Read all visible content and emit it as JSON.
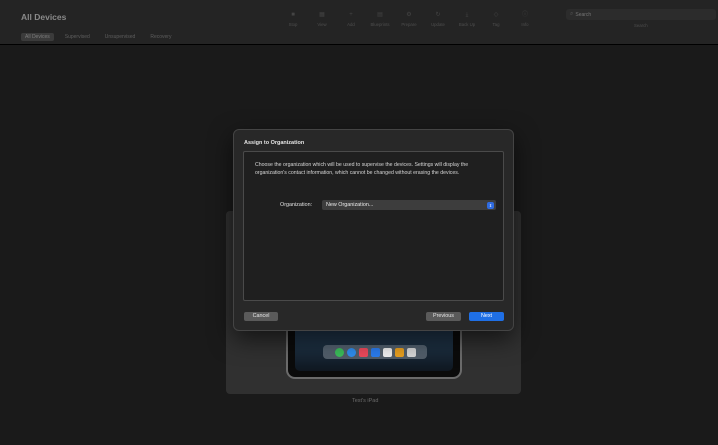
{
  "app": {
    "title": "All Devices",
    "filter_tabs": [
      "All Devices",
      "Supervised",
      "Unsupervised",
      "Recovery"
    ]
  },
  "toolbar": {
    "items": [
      {
        "label": "Stop",
        "icon": "stop-icon"
      },
      {
        "label": "View",
        "icon": "view-icon"
      },
      {
        "label": "Add",
        "icon": "add-icon"
      },
      {
        "label": "Blueprints",
        "icon": "blueprints-icon"
      },
      {
        "label": "Prepare",
        "icon": "prepare-icon"
      },
      {
        "label": "Update",
        "icon": "update-icon"
      },
      {
        "label": "Back Up",
        "icon": "backup-icon"
      },
      {
        "label": "Tag",
        "icon": "tag-icon"
      },
      {
        "label": "Info",
        "icon": "info-icon"
      }
    ],
    "search_placeholder": "Search",
    "search_label": "Search"
  },
  "dialog": {
    "title": "Assign to Organization",
    "description": "Choose the organization which will be used to supervise the devices. Settings will display the organization's contact information, which cannot be changed without erasing the devices.",
    "organization_label": "Organization:",
    "organization_value": "New Organization...",
    "cancel_label": "Cancel",
    "previous_label": "Previous",
    "next_label": "Next"
  },
  "device": {
    "name": "Test's iPad"
  },
  "colors": {
    "accent": "#1f6fe5",
    "background": "#1a1a1a"
  }
}
